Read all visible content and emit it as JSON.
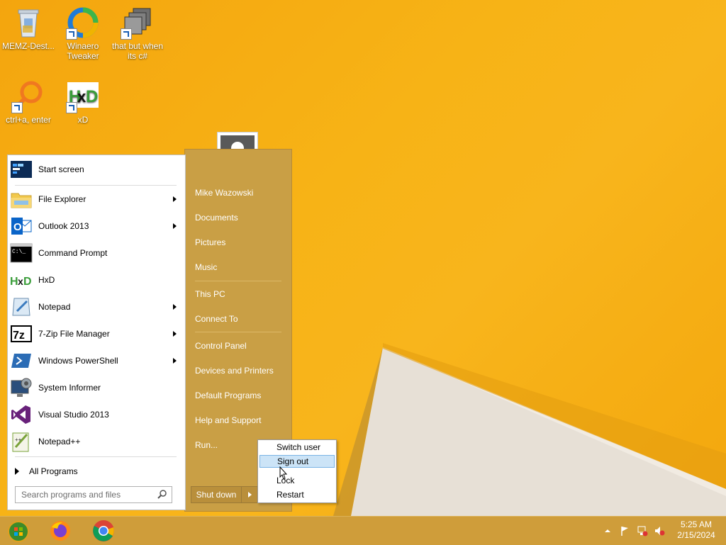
{
  "desktop": {
    "icons": [
      {
        "label": "MEMZ-Dest...",
        "icon": "recycle-bin-icon"
      },
      {
        "label": "Winaero Tweaker",
        "icon": "winaero-icon"
      },
      {
        "label": "that but when its c#",
        "icon": "folder-stack-icon"
      },
      {
        "label": "ctrl+a, enter",
        "icon": "magnifier-icon"
      },
      {
        "label": "xD",
        "icon": "hxd-icon"
      }
    ]
  },
  "start_menu": {
    "programs": [
      {
        "label": "Start screen",
        "icon": "start-screen-icon",
        "submenu": false
      },
      {
        "label": "File Explorer",
        "icon": "file-explorer-icon",
        "submenu": true
      },
      {
        "label": "Outlook 2013",
        "icon": "outlook-icon",
        "submenu": true
      },
      {
        "label": "Command Prompt",
        "icon": "command-prompt-icon",
        "submenu": false
      },
      {
        "label": "HxD",
        "icon": "hxd-icon",
        "submenu": false
      },
      {
        "label": "Notepad",
        "icon": "notepad-icon",
        "submenu": true
      },
      {
        "label": "7-Zip File Manager",
        "icon": "7zip-icon",
        "submenu": true
      },
      {
        "label": "Windows PowerShell",
        "icon": "powershell-icon",
        "submenu": true
      },
      {
        "label": "System Informer",
        "icon": "system-informer-icon",
        "submenu": false
      },
      {
        "label": "Visual Studio 2013",
        "icon": "visual-studio-icon",
        "submenu": false
      },
      {
        "label": "Notepad++",
        "icon": "notepadpp-icon",
        "submenu": false
      }
    ],
    "all_programs": "All Programs",
    "search_placeholder": "Search programs and files",
    "right": {
      "user": "Mike Wazowski",
      "items": [
        "Documents",
        "Pictures",
        "Music",
        "This PC",
        "Connect To",
        "Control Panel",
        "Devices and Printers",
        "Default Programs",
        "Help and Support",
        "Run..."
      ]
    },
    "shutdown_label": "Shut down",
    "power_submenu": [
      "Switch user",
      "Sign out",
      "Lock",
      "Restart"
    ],
    "highlighted": "Sign out"
  },
  "taskbar": {
    "apps": [
      "start-orb-icon",
      "firefox-icon",
      "chrome-icon"
    ],
    "time": "5:25 AM",
    "date": "2/15/2024"
  },
  "colors": {
    "wallpaper": "#f7b316",
    "start_right_panel": "#c99f45",
    "taskbar": "#cf9d3a",
    "highlight": "#cce4f7"
  }
}
